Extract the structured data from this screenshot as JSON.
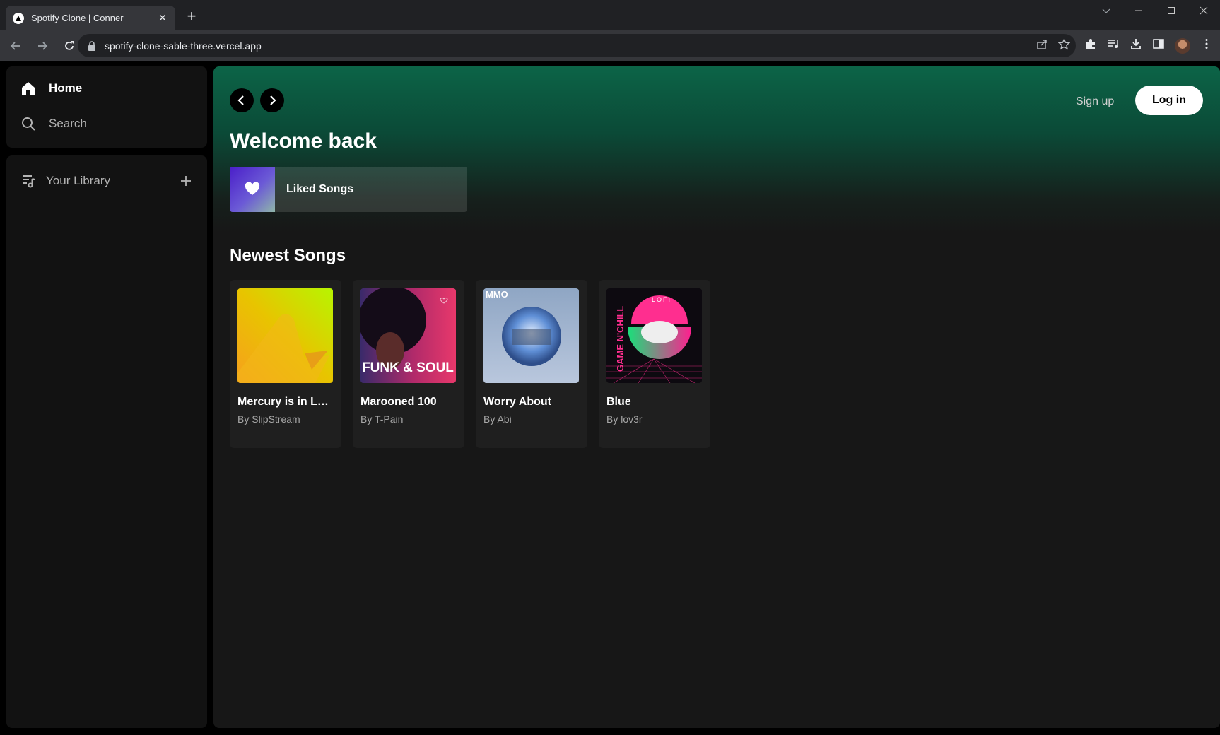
{
  "browser": {
    "tab_title": "Spotify Clone | Conner",
    "url": "spotify-clone-sable-three.vercel.app"
  },
  "sidebar": {
    "home_label": "Home",
    "search_label": "Search",
    "library_label": "Your Library"
  },
  "header": {
    "signup_label": "Sign up",
    "login_label": "Log in"
  },
  "main": {
    "greeting": "Welcome back",
    "liked_label": "Liked Songs",
    "section_title": "Newest Songs",
    "songs": [
      {
        "title": "Mercury is in Le...",
        "artist": "By SlipStream"
      },
      {
        "title": "Marooned 100",
        "artist": "By T-Pain"
      },
      {
        "title": "Worry About",
        "artist": "By Abi"
      },
      {
        "title": "Blue",
        "artist": "By lov3r"
      }
    ],
    "cover_text": {
      "funk": "FUNK & SOUL",
      "mmo": "MMO",
      "game": "GAME N'CHILL",
      "lofi": "LOFI"
    }
  },
  "colors": {
    "accent_green": "#0c6447",
    "background": "#121212"
  }
}
